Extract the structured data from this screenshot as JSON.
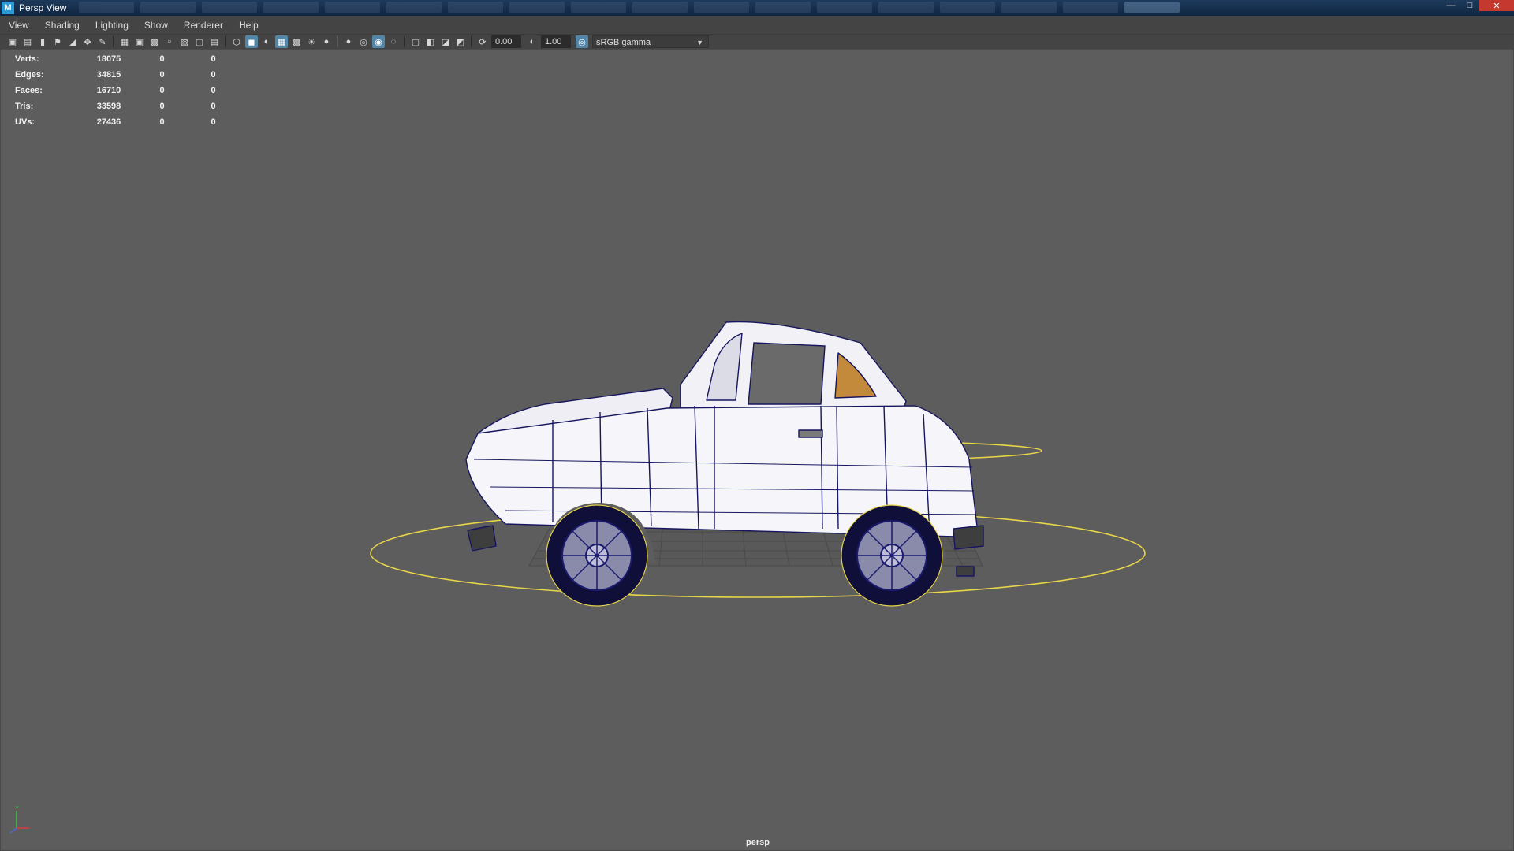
{
  "window": {
    "title": "Persp View",
    "logo": "M"
  },
  "menu": [
    "View",
    "Shading",
    "Lighting",
    "Show",
    "Renderer",
    "Help"
  ],
  "toolbar": {
    "groups": [
      [
        "camera-icon",
        "camera-attr-icon",
        "bookmark-icon",
        "pin-icon",
        "image-plane-icon",
        "pan-zoom-icon",
        "grease-pencil-icon"
      ],
      [
        "grid-icon",
        "film-gate-icon",
        "resolution-gate-icon",
        "gate-mask-icon",
        "field-chart-icon",
        "safe-action-icon",
        "safe-title-icon"
      ],
      [
        "wireframe-icon",
        "smooth-shade-icon",
        "default-material-icon",
        "wireframe-on-shaded-icon",
        "textured-icon",
        "lights-icon",
        "shadows-icon"
      ],
      [
        "ambient-occlusion-icon",
        "motion-blur-icon",
        "anti-alias-icon",
        "depth-of-field-icon"
      ],
      [
        "isolate-select-icon",
        "xray-icon",
        "xray-joints-icon",
        "xray-components-icon"
      ]
    ],
    "active_icons": [
      "smooth-shade-icon",
      "wireframe-on-shaded-icon",
      "anti-alias-icon"
    ],
    "exposure_value": "0.00",
    "gamma_value": "1.00",
    "color_space": "sRGB gamma"
  },
  "hud": {
    "rows": [
      {
        "label": "Verts:",
        "v1": "18075",
        "v2": "0",
        "v3": "0"
      },
      {
        "label": "Edges:",
        "v1": "34815",
        "v2": "0",
        "v3": "0"
      },
      {
        "label": "Faces:",
        "v1": "16710",
        "v2": "0",
        "v3": "0"
      },
      {
        "label": "Tris:",
        "v1": "33598",
        "v2": "0",
        "v3": "0"
      },
      {
        "label": "UVs:",
        "v1": "27436",
        "v2": "0",
        "v3": "0"
      }
    ]
  },
  "viewport": {
    "camera_name": "persp",
    "axis_y_label": "Y"
  },
  "colors": {
    "viewport_bg": "#5d5d5d",
    "selection_yellow": "#e8d54a",
    "wireframe_blue": "#1a1a6e",
    "car_body": "#f4f4f8",
    "accent": "#5285a6"
  }
}
